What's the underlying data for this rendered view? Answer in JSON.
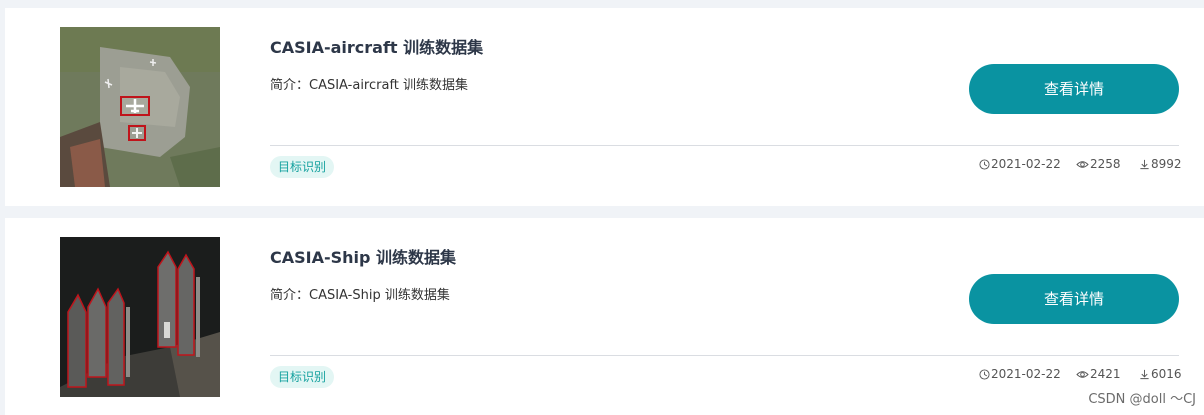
{
  "datasets": [
    {
      "title": "CASIA-aircraft 训练数据集",
      "description": "简介：CASIA-aircraft 训练数据集",
      "button_label": "查看详情",
      "tag": "目标识别",
      "date": "2021-02-22",
      "views": "2258",
      "downloads": "8992",
      "thumbnail_icon": "aircraft-satellite-image"
    },
    {
      "title": "CASIA-Ship 训练数据集",
      "description": "简介：CASIA-Ship 训练数据集",
      "button_label": "查看详情",
      "tag": "目标识别",
      "date": "2021-02-22",
      "views": "2421",
      "downloads": "6016",
      "thumbnail_icon": "ship-satellite-image"
    }
  ],
  "watermark": "CSDN @doll ～CJ",
  "colors": {
    "accent": "#0a93a1",
    "tag_bg": "#e3f6f4",
    "tag_text": "#17a2a0",
    "page_bg": "#f0f3f7"
  }
}
